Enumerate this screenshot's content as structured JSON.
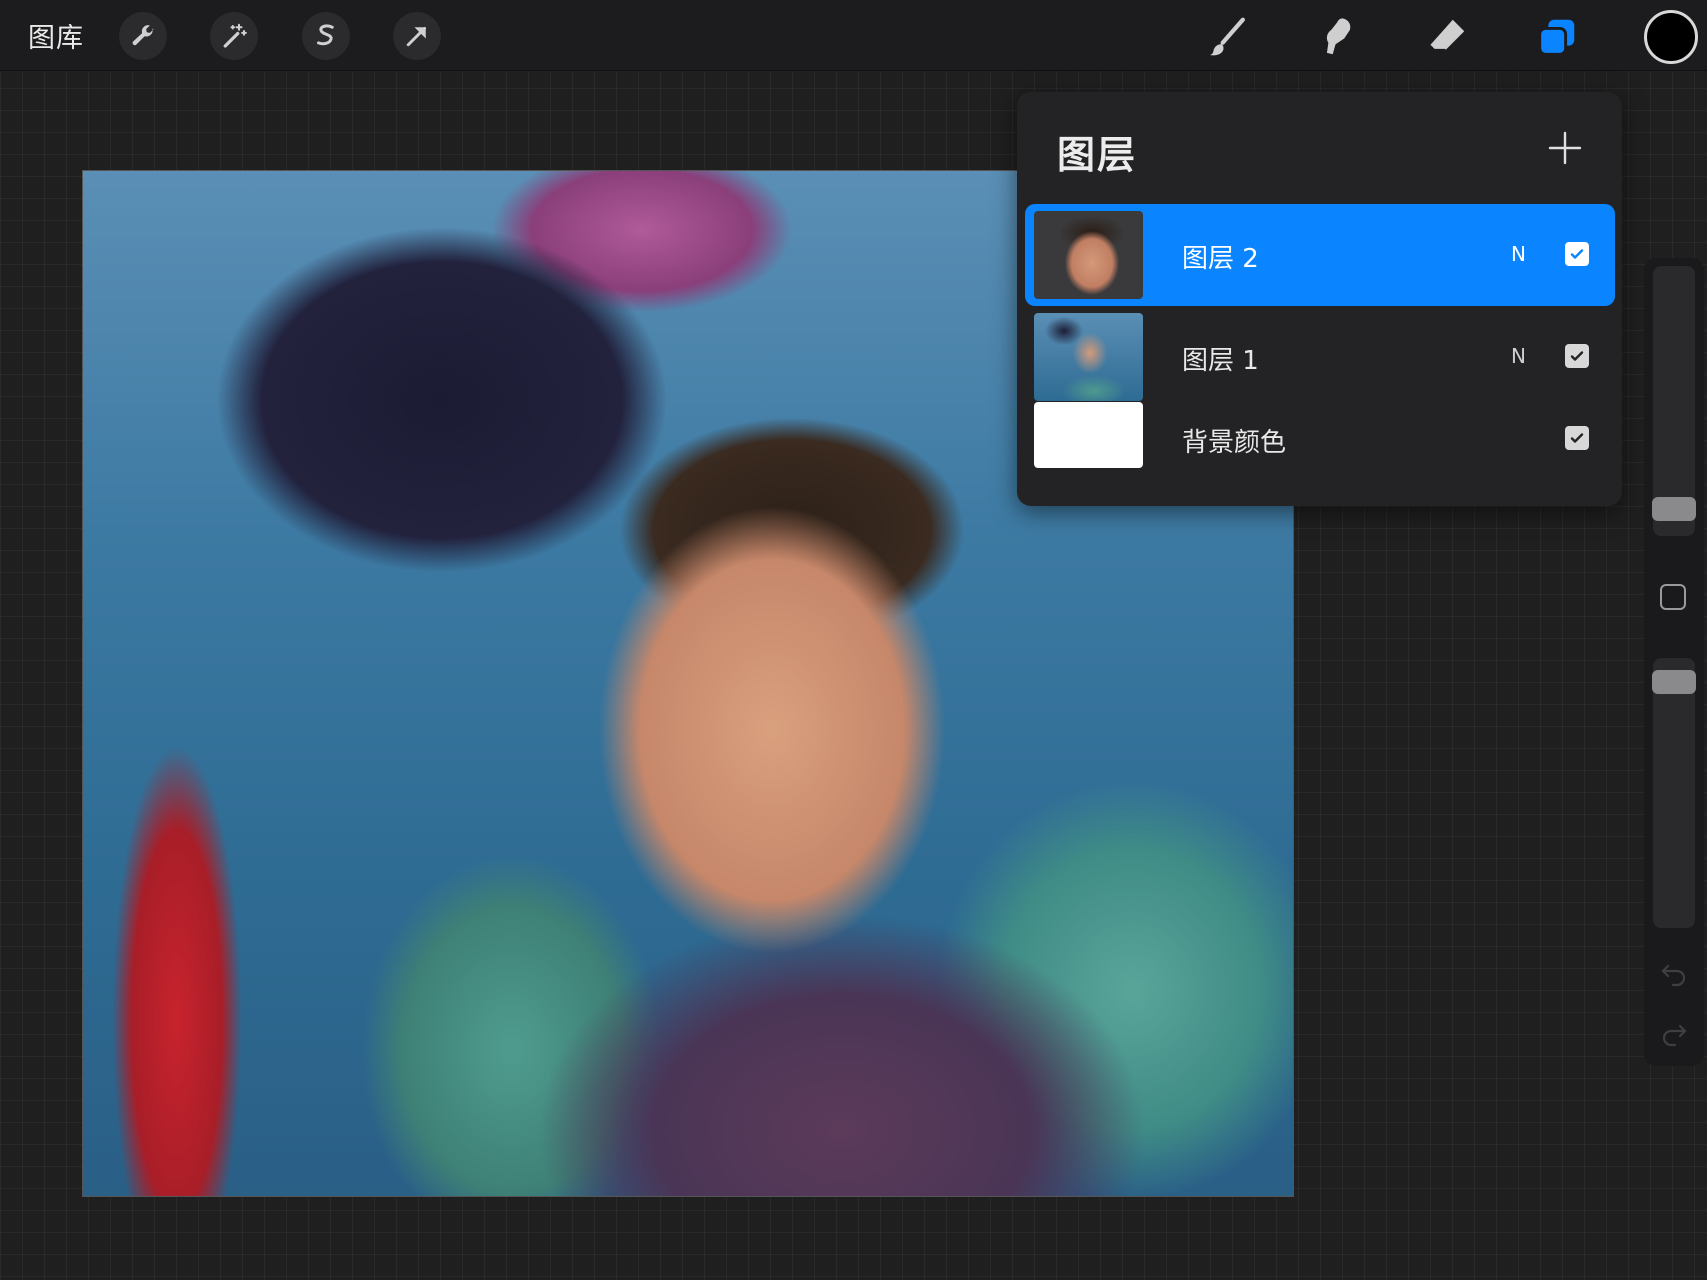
{
  "toolbar": {
    "gallery_label": "图库",
    "left_tools": [
      "wrench-icon",
      "magic-wand-icon",
      "selection-icon",
      "move-arrow-icon"
    ],
    "right_tools": [
      "brush-icon",
      "smudge-icon",
      "eraser-icon",
      "layers-icon"
    ],
    "active_color": "#000000",
    "accent": "#0a84ff"
  },
  "layers_panel": {
    "title": "图层",
    "add_icon": "plus-icon",
    "layers": [
      {
        "name": "图层 2",
        "blend": "N",
        "visible": true,
        "selected": true
      },
      {
        "name": "图层 1",
        "blend": "N",
        "visible": true,
        "selected": false
      },
      {
        "name": "背景颜色",
        "blend": "",
        "visible": true,
        "selected": false
      }
    ]
  },
  "sidebar": {
    "brush_size": 0.06,
    "opacity": 0.95,
    "modify_icon": "square-icon",
    "undo_icon": "undo-icon",
    "redo_icon": "redo-icon"
  }
}
